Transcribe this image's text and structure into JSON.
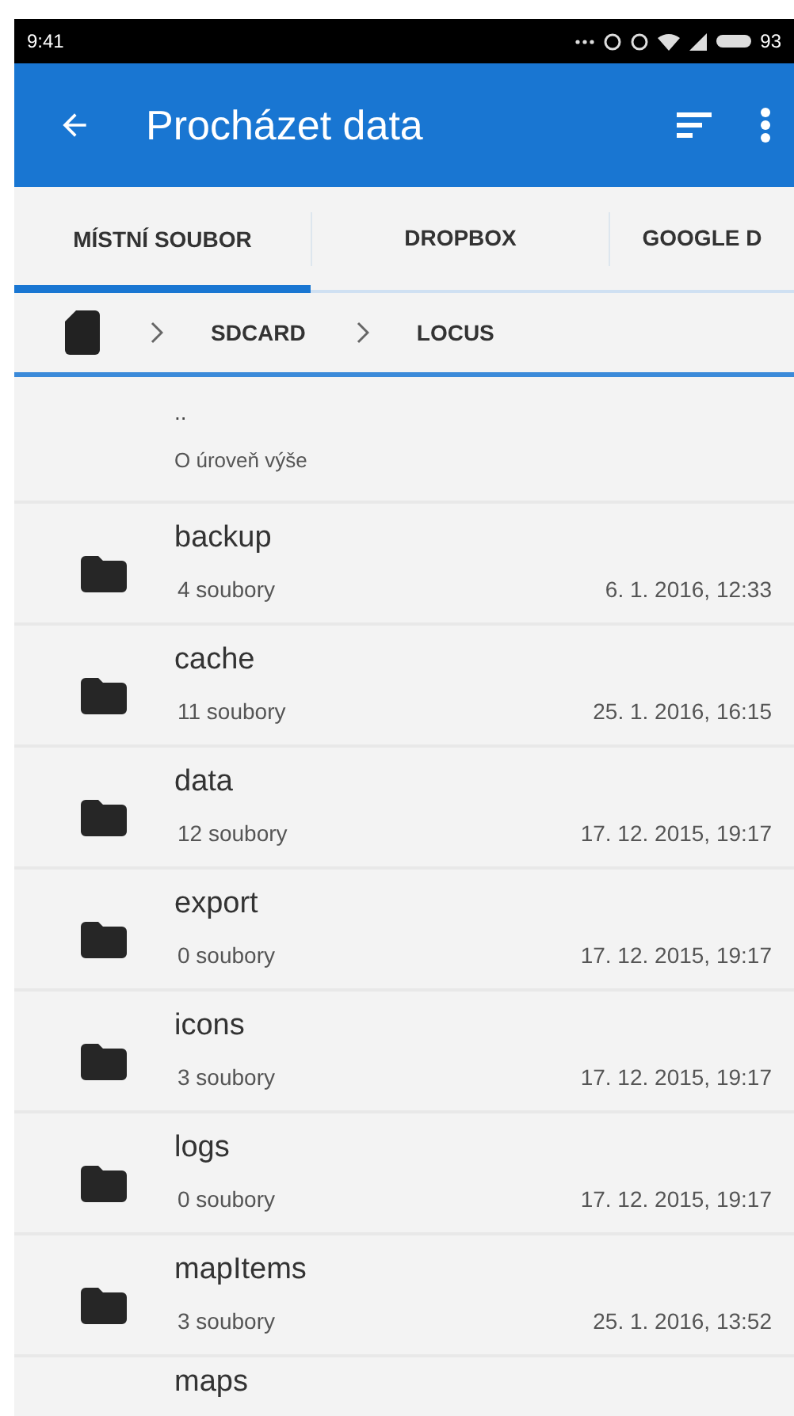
{
  "status_bar": {
    "time": "9:41",
    "battery": "93"
  },
  "app_bar": {
    "title": "Procházet data"
  },
  "tabs": [
    {
      "label": "MÍSTNÍ SOUBOR",
      "selected": true
    },
    {
      "label": "DROPBOX",
      "selected": false
    },
    {
      "label": "GOOGLE D",
      "selected": false
    }
  ],
  "breadcrumb": [
    "SDCARD",
    "LOCUS"
  ],
  "parent_row": {
    "name": "..",
    "subtitle": "O úroveň výše"
  },
  "folders": [
    {
      "name": "backup",
      "count": "4 soubory",
      "date": "6. 1. 2016, 12:33"
    },
    {
      "name": "cache",
      "count": "11 soubory",
      "date": "25. 1. 2016, 16:15"
    },
    {
      "name": "data",
      "count": "12 soubory",
      "date": "17. 12. 2015, 19:17"
    },
    {
      "name": "export",
      "count": "0 soubory",
      "date": "17. 12. 2015, 19:17"
    },
    {
      "name": "icons",
      "count": "3 soubory",
      "date": "17. 12. 2015, 19:17"
    },
    {
      "name": "logs",
      "count": "0 soubory",
      "date": "17. 12. 2015, 19:17"
    },
    {
      "name": "mapItems",
      "count": "3 soubory",
      "date": "25. 1. 2016, 13:52"
    },
    {
      "name": "maps"
    }
  ]
}
